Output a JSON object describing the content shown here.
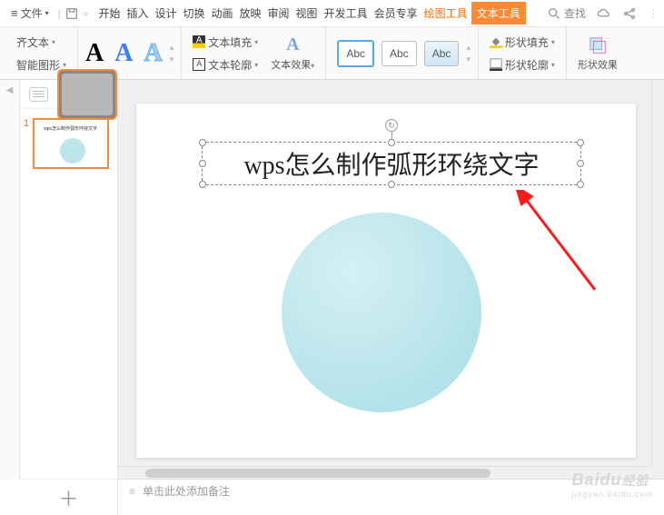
{
  "menu": {
    "file_label": "文件",
    "tabs": [
      "开始",
      "插入",
      "设计",
      "切换",
      "动画",
      "放映",
      "审阅",
      "视图",
      "开发工具",
      "会员专享"
    ],
    "context_tab1": "绘图工具",
    "context_tab2": "文本工具",
    "search_label": "查找"
  },
  "ribbon": {
    "left_group": {
      "item1": "齐文本",
      "item2": "智能图形"
    },
    "wordart_a": "A",
    "text_fill": "文本填充",
    "text_outline": "文本轮廓",
    "text_effects": "文本效果",
    "abc_label": "Abc",
    "shape_fill": "形状填充",
    "shape_outline": "形状轮廓",
    "shape_effects": "形状效果"
  },
  "slides": {
    "current_num": "1",
    "thumb_text": "wps怎么制作弧形环绕文字"
  },
  "canvas": {
    "textbox_content": "wps怎么制作弧形环绕文字"
  },
  "notes": {
    "placeholder": "单击此处添加备注"
  },
  "watermark": {
    "brand": "Baidu",
    "sub": "经验",
    "url": "jingyan.baidu.com"
  }
}
